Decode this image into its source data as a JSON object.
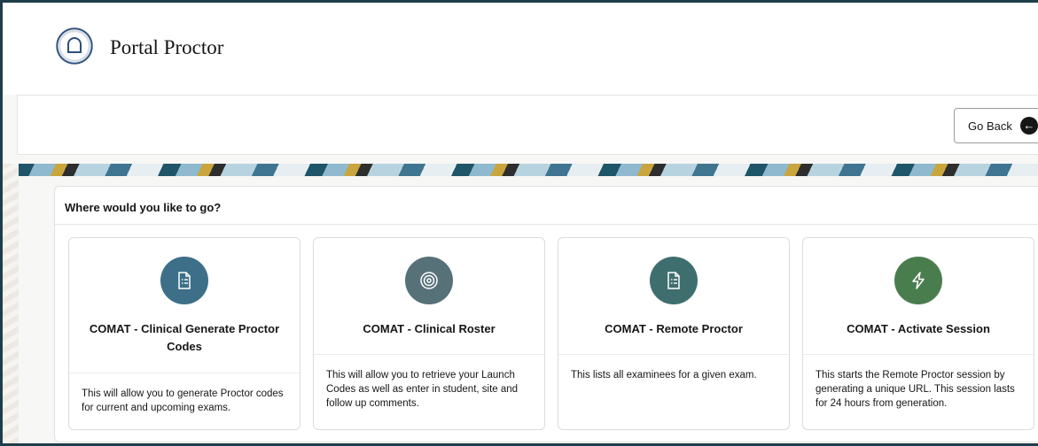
{
  "header": {
    "title": "Portal Proctor"
  },
  "toolbar": {
    "go_back_label": "Go Back"
  },
  "panel": {
    "title": "Where would you like to go?",
    "cards": [
      {
        "title": "COMAT - Clinical Generate Proctor Codes",
        "description": "This will allow you to generate Proctor codes for current and upcoming exams.",
        "icon": "list-document-icon",
        "color": "#3d6f88"
      },
      {
        "title": "COMAT - Clinical Roster",
        "description": "This will allow you to retrieve your Launch Codes as well as enter in student, site and follow up comments.",
        "icon": "target-icon",
        "color": "#567178"
      },
      {
        "title": "COMAT - Remote Proctor",
        "description": "This lists all examinees for a given exam.",
        "icon": "list-document-icon",
        "color": "#3f6e6e"
      },
      {
        "title": "COMAT - Activate Session",
        "description": "This starts the Remote Proctor session by generating a unique URL. This session lasts for 24 hours from generation.",
        "icon": "lightning-icon",
        "color": "#4a7d4e"
      }
    ]
  }
}
